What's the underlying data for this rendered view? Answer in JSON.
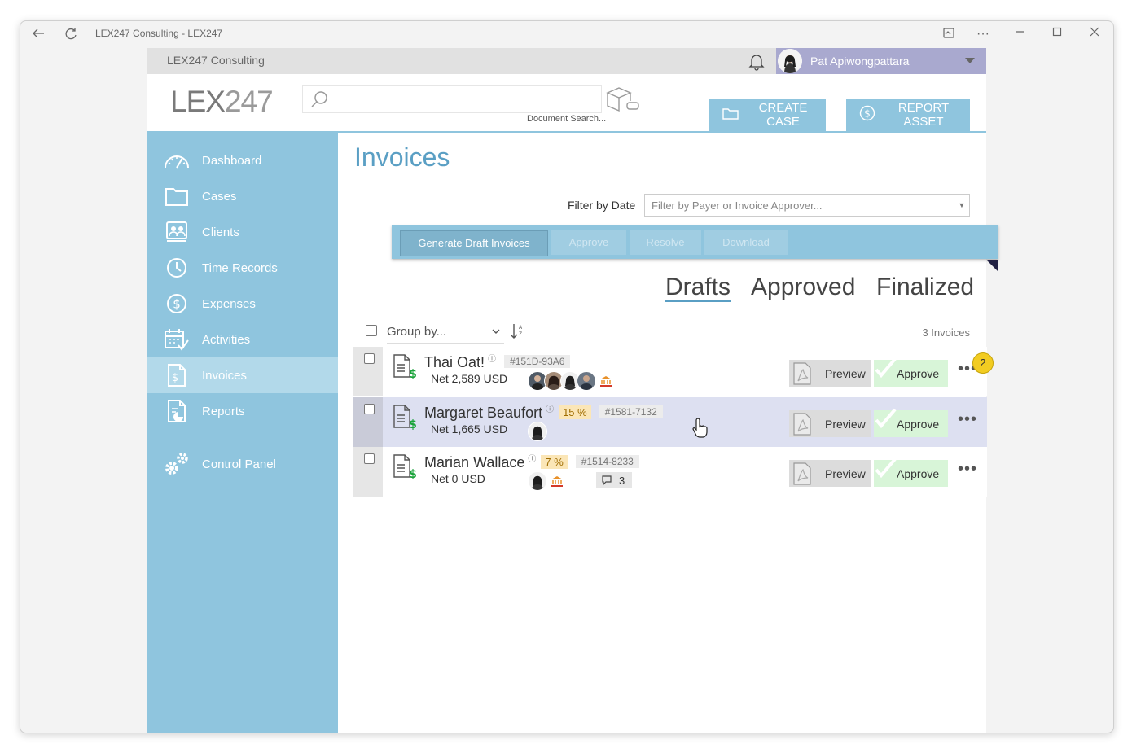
{
  "window": {
    "title": "LEX247 Consulting - LEX247"
  },
  "topbar": {
    "company": "LEX247 Consulting",
    "user_name": "Pat Apiwongpattara"
  },
  "header": {
    "logo_part1": "LEX",
    "logo_part2": "247",
    "search_placeholder": "",
    "search_hint": "Document Search...",
    "create_case_label": "CREATE CASE",
    "report_asset_label": "REPORT ASSET"
  },
  "sidebar": {
    "items": [
      {
        "label": "Dashboard",
        "icon": "dashboard-icon"
      },
      {
        "label": "Cases",
        "icon": "folder-icon"
      },
      {
        "label": "Clients",
        "icon": "clients-icon"
      },
      {
        "label": "Time Records",
        "icon": "clock-icon"
      },
      {
        "label": "Expenses",
        "icon": "dollar-circle-icon"
      },
      {
        "label": "Activities",
        "icon": "calendar-check-icon"
      },
      {
        "label": "Invoices",
        "icon": "invoice-icon",
        "active": true
      },
      {
        "label": "Reports",
        "icon": "report-icon"
      },
      {
        "label": "Control Panel",
        "icon": "gears-icon"
      }
    ]
  },
  "main": {
    "title": "Invoices",
    "filter_label": "Filter by Date",
    "filter_placeholder": "Filter by Payer or Invoice Approver...",
    "toolbar": {
      "generate_label": "Generate Draft Invoices",
      "approve_label": "Approve",
      "resolve_label": "Resolve",
      "download_label": "Download"
    },
    "tabs": [
      "Drafts",
      "Approved",
      "Finalized"
    ],
    "active_tab": "Drafts",
    "group_by_label": "Group by...",
    "invoice_count": "3 Invoices",
    "badge_count": "2",
    "row_buttons": {
      "preview_label": "Preview",
      "approve_label": "Approve"
    },
    "invoices": [
      {
        "name": "Thai Oat!",
        "pct": "",
        "id": "#151D-93A6",
        "net": "Net 2,589 USD",
        "comments": ""
      },
      {
        "name": "Margaret Beaufort",
        "pct": "15 %",
        "id": "#1581-7132",
        "net": "Net 1,665 USD",
        "comments": ""
      },
      {
        "name": "Marian Wallace",
        "pct": "7 %",
        "id": "#1514-8233",
        "net": "Net 0 USD",
        "comments": "3"
      }
    ]
  },
  "colors": {
    "sidebar": "#8fc5de",
    "sidebar_active": "#b2d9ea",
    "accent": "#5a9fc4",
    "user_bar": "#a9a9cf",
    "badge": "#f2cc22"
  }
}
